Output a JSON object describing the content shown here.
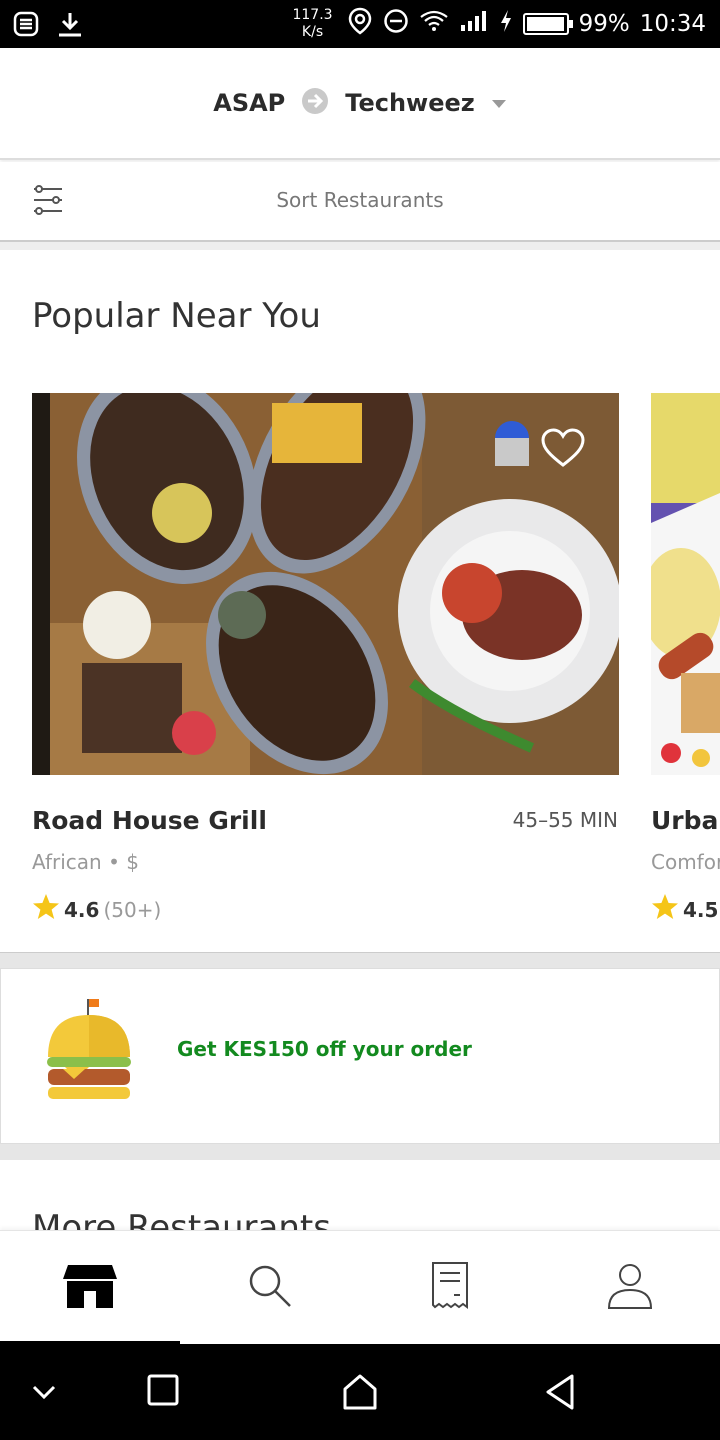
{
  "status_bar": {
    "net_speed_value": "117.3",
    "net_speed_unit": "K/s",
    "battery": "99%",
    "time": "10:34",
    "battery_level": 0.99
  },
  "header": {
    "when": "ASAP",
    "location": "Techweez"
  },
  "sort": {
    "label": "Sort Restaurants"
  },
  "popular": {
    "title": "Popular Near You",
    "restaurants": [
      {
        "name": "Road House Grill",
        "time": "45–55 MIN",
        "cuisine": "African",
        "price": "$",
        "rating": "4.6",
        "reviews": "(50+)"
      },
      {
        "name": "Urbar",
        "cuisine": "Comfor",
        "rating": "4.5"
      }
    ]
  },
  "promo": {
    "text": "Get KES150 off your order"
  },
  "more": {
    "title": "More Restaurants"
  },
  "colors": {
    "promo_green": "#138a1f",
    "star": "#f5c518",
    "accent_dark": "#000000"
  }
}
